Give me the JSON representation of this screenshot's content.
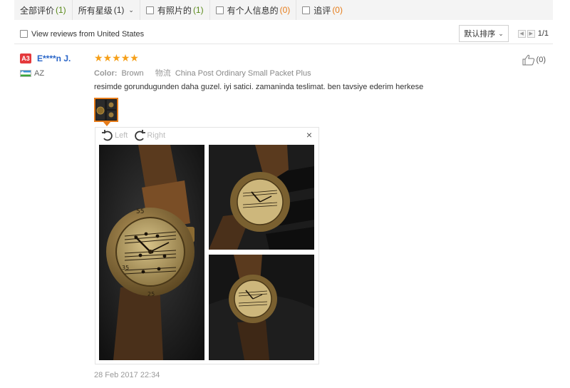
{
  "filters": [
    {
      "label": "全部评价",
      "count": "(1)",
      "count_color": "green",
      "type": "plain"
    },
    {
      "label": "所有星级",
      "count": "(1)",
      "count_color": "none",
      "type": "dropdown"
    },
    {
      "label": "有照片的",
      "count": "(1)",
      "count_color": "green",
      "type": "checkbox"
    },
    {
      "label": "有个人信息的",
      "count": "(0)",
      "count_color": "orange",
      "type": "checkbox"
    },
    {
      "label": "追评",
      "count": "(0)",
      "count_color": "orange",
      "type": "checkbox"
    }
  ],
  "subbar": {
    "country_filter_label": "View reviews from United States",
    "sort_label": "默认排序",
    "page_indicator": "1/1"
  },
  "review": {
    "level": "A3",
    "user": "E****n J.",
    "country": "AZ",
    "rating": 5,
    "color_label": "Color:",
    "color_value": "Brown",
    "shipping_label": "物流",
    "shipping_value": "China Post Ordinary Small Packet Plus",
    "text": "resimde gorundugunden daha guzel. iyi satici. zamaninda teslimat. ben tavsiye ederim herkese",
    "likes": "(0)",
    "date": "28 Feb 2017 22:34"
  },
  "viewer": {
    "left_label": "Left",
    "right_label": "Right",
    "close": "×"
  },
  "colors": {
    "accent": "#e67c1a",
    "star": "#f6a01a",
    "username": "#2a66c8",
    "badge": "#e4393c"
  }
}
